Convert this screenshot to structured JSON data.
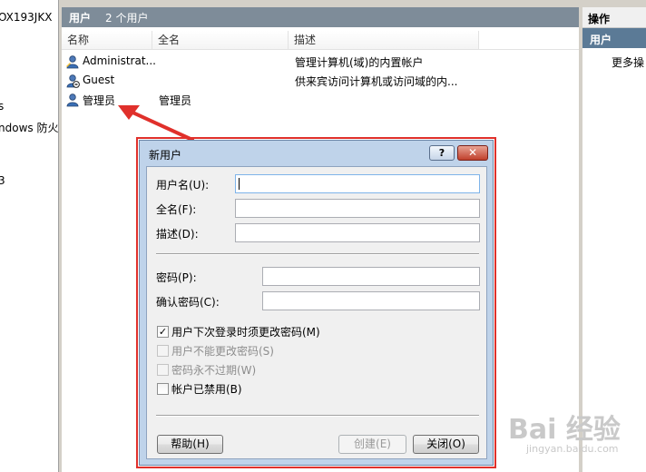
{
  "left_tree": {
    "items": [
      {
        "label": "OX193JKX"
      },
      {
        "label": "s"
      },
      {
        "label": "ndows 防火"
      },
      {
        "label": "3"
      }
    ]
  },
  "center": {
    "header_title": "用户",
    "header_count": "2 个用户",
    "columns": [
      "名称",
      "全名",
      "描述"
    ],
    "rows": [
      {
        "name": "Administrat...",
        "fullname": "",
        "description": "管理计算机(域)的内置帐户"
      },
      {
        "name": "Guest",
        "fullname": "",
        "description": "供来宾访问计算机或访问域的内..."
      },
      {
        "name": "管理员",
        "fullname": "管理员",
        "description": ""
      }
    ]
  },
  "actions": {
    "title": "操作",
    "section": "用户",
    "more": "更多操"
  },
  "dialog": {
    "title": "新用户",
    "help_glyph": "?",
    "close_glyph": "✕",
    "username_label": "用户名(U):",
    "username_value": "",
    "fullname_label": "全名(F):",
    "fullname_value": "",
    "description_label": "描述(D):",
    "description_value": "",
    "password_label": "密码(P):",
    "confirm_label": "确认密码(C):",
    "checks": [
      {
        "label": "用户下次登录时须更改密码(M)",
        "checked": true,
        "enabled": true
      },
      {
        "label": "用户不能更改密码(S)",
        "checked": false,
        "enabled": false
      },
      {
        "label": "密码永不过期(W)",
        "checked": false,
        "enabled": false
      },
      {
        "label": "帐户已禁用(B)",
        "checked": false,
        "enabled": true
      }
    ],
    "help_button": "帮助(H)",
    "create_button": "创建(E)",
    "close_button": "关闭(O)"
  },
  "watermark": {
    "text": "Bai 经验",
    "sub": "jingyan.baidu.com"
  },
  "colors": {
    "dialog_frame": "#bfd3ea",
    "highlight_red": "#e0302b",
    "header_bg": "#7e8c99"
  }
}
